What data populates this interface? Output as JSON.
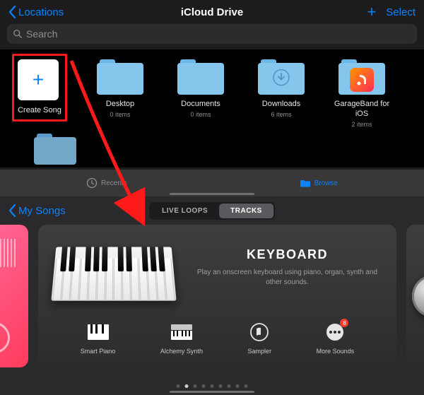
{
  "panel1": {
    "back_label": "Locations",
    "title": "iCloud Drive",
    "select_label": "Select",
    "search_placeholder": "Search",
    "items": [
      {
        "label": "Create Song",
        "sub": ""
      },
      {
        "label": "Desktop",
        "sub": "0 items"
      },
      {
        "label": "Documents",
        "sub": "0 items"
      },
      {
        "label": "Downloads",
        "sub": "6 items"
      },
      {
        "label": "GarageBand for iOS",
        "sub": "2 items"
      }
    ],
    "tabs": {
      "recents": "Recents",
      "browse": "Browse"
    }
  },
  "panel2": {
    "back_label": "My Songs",
    "seg": {
      "live": "LIVE LOOPS",
      "tracks": "TRACKS"
    },
    "card": {
      "title": "KEYBOARD",
      "desc": "Play an onscreen keyboard using piano, organ, synth and other sounds."
    },
    "subs": [
      {
        "label": "Smart Piano"
      },
      {
        "label": "Alchemy Synth"
      },
      {
        "label": "Sampler"
      },
      {
        "label": "More Sounds",
        "badge": "8"
      }
    ],
    "page_dots": {
      "total": 9,
      "active": 1
    }
  }
}
